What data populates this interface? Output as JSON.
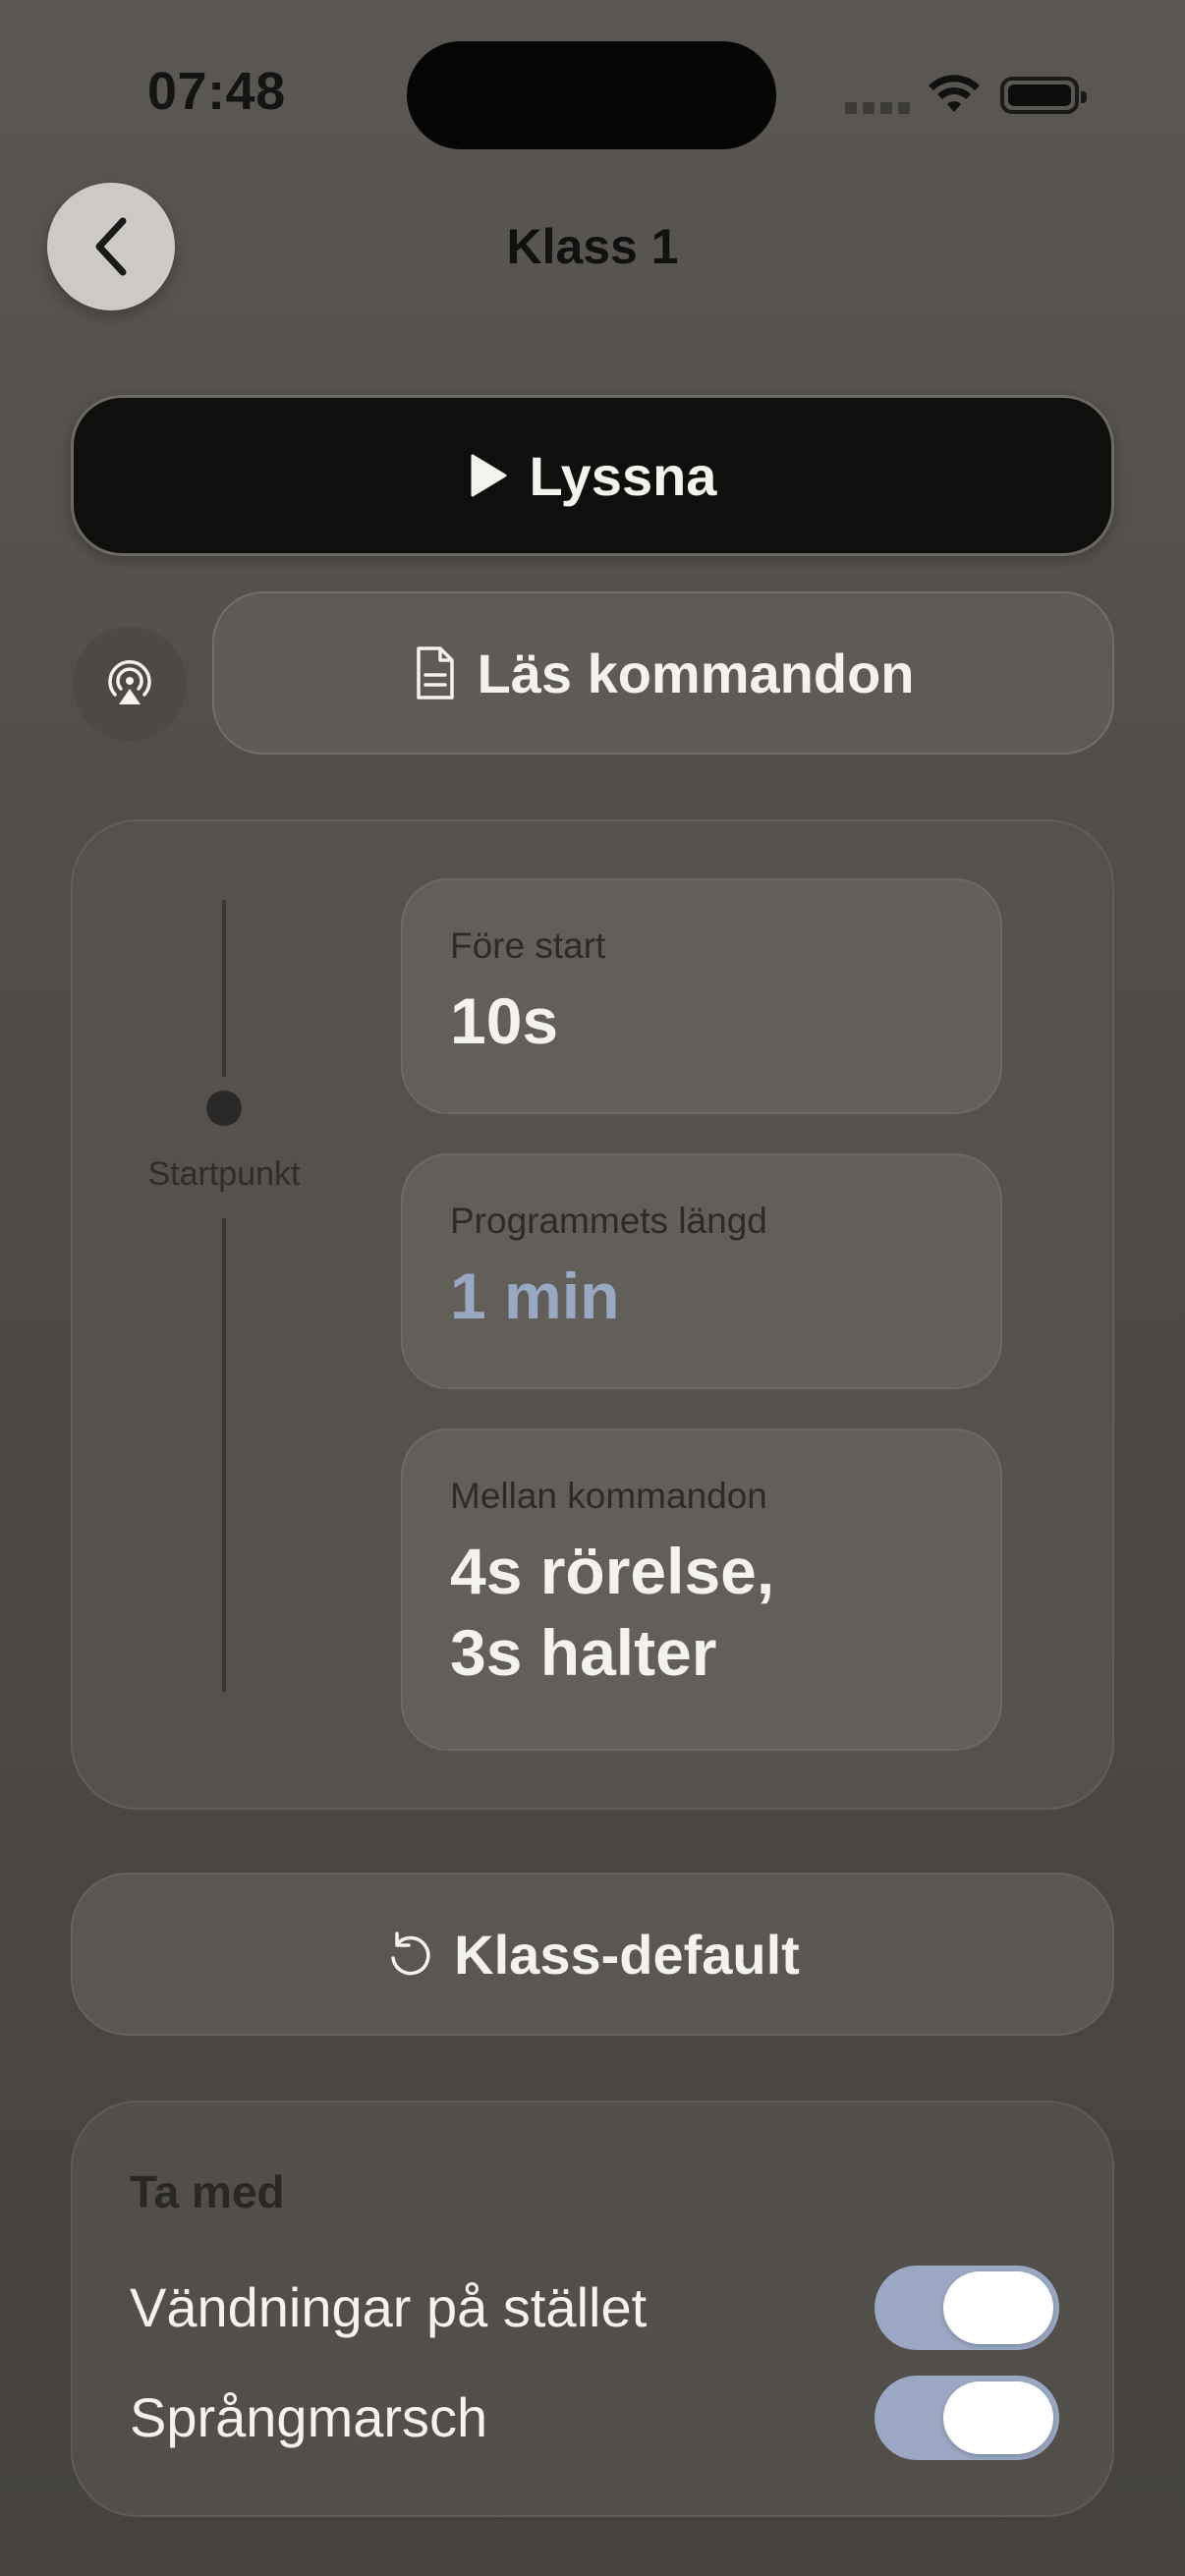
{
  "status_bar": {
    "time": "07:48"
  },
  "nav": {
    "title": "Klass 1"
  },
  "actions": {
    "listen_label": "Lyssna",
    "read_commands_label": "Läs kommandon",
    "reset_label": "Klass-default"
  },
  "timeline": {
    "start_label": "Startpunkt"
  },
  "settings": {
    "pre_start": {
      "label": "Före start",
      "value": "10s"
    },
    "program_length": {
      "label": "Programmets längd",
      "value": "1 min"
    },
    "between_commands": {
      "label": "Mellan kommandon",
      "value_line1": "4s rörelse,",
      "value_line2": "3s halter"
    }
  },
  "include": {
    "title": "Ta med",
    "items": [
      {
        "label": "Vändningar på stället",
        "enabled": true
      },
      {
        "label": "Språngmarsch",
        "enabled": true
      }
    ]
  },
  "colors": {
    "accent": "#9aa9c3",
    "toggle_on": "#9aa8c4"
  }
}
